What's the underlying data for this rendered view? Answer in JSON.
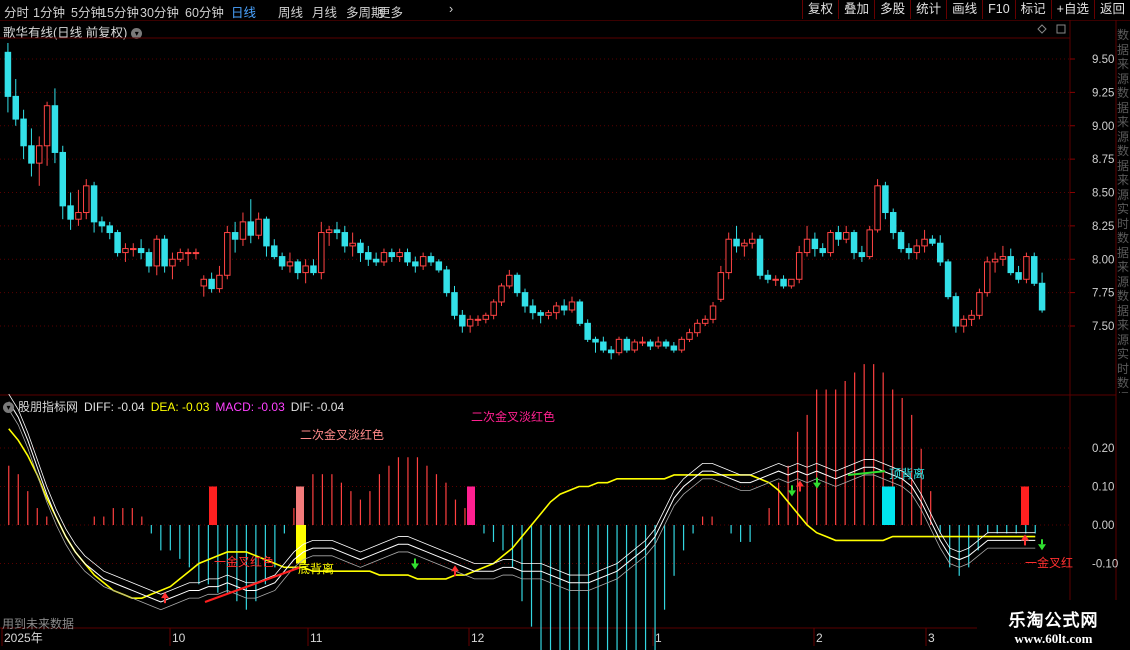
{
  "periods": [
    {
      "label": "分时",
      "active": false
    },
    {
      "label": "1分钟",
      "active": false
    },
    {
      "label": "5分钟",
      "active": false
    },
    {
      "label": "15分钟",
      "active": false
    },
    {
      "label": "30分钟",
      "active": false
    },
    {
      "label": "60分钟",
      "active": false
    },
    {
      "label": "日线",
      "active": true
    },
    {
      "label": "周线",
      "active": false
    },
    {
      "label": "月线",
      "active": false
    },
    {
      "label": "多周期",
      "active": false
    },
    {
      "label": "更多",
      "active": false
    }
  ],
  "toolbar_right": [
    "复权",
    "叠加",
    "多股",
    "统计",
    "画线",
    "F10",
    "标记",
    "+自选",
    "返回"
  ],
  "main_title": "歌华有线(日线 前复权)",
  "price_axis": [
    "9.50",
    "9.25",
    "9.00",
    "8.75",
    "8.50",
    "8.25",
    "8.00",
    "7.75",
    "7.50"
  ],
  "indicator": {
    "name": "股朋指标网",
    "diff_label": "DIFF: -0.04",
    "dea_label": "DEA: -0.03",
    "macd_label": "MACD: -0.03",
    "dif_label": "DIF: -0.04"
  },
  "macd_axis": [
    "0.20",
    "0.10",
    "0.00",
    "-0.10"
  ],
  "annotations": {
    "second_cross": "二次金叉淡红色",
    "second_cross_faded": "二次金叉淡红色",
    "first_cross_left": "一金叉红色",
    "bottom_divergence": "底背离",
    "top_divergence": "顶背离",
    "first_cross_right": "一金叉红"
  },
  "date_axis": [
    "2025年",
    "10",
    "11",
    "12",
    "1",
    "2",
    "3"
  ],
  "future_data_label": "用到未来数据",
  "watermark": {
    "line1": "乐淘公式网",
    "line2": "www.60lt.com"
  },
  "side_text": "数据来源数据来源数据来源实时数据来源数据来源实时数据来源板块资金流向",
  "colors": {
    "up": "#ff4444",
    "down": "#33e0e8",
    "dea": "#ffff00",
    "dif": "#ffffff",
    "bar_red": "#ff2020",
    "bar_pink": "#f27c7c",
    "bar_magenta": "#ff2090",
    "bar_yellow": "#ffff00",
    "bar_cyan": "#00e5ee",
    "grid": "#5a0000"
  },
  "chart_data": {
    "type": "candlestick",
    "ylim": [
      7.2,
      9.7
    ],
    "candles": [
      [
        9.55,
        9.62,
        9.1,
        9.22
      ],
      [
        9.22,
        9.35,
        9.0,
        9.05
      ],
      [
        9.05,
        9.12,
        8.75,
        8.85
      ],
      [
        8.85,
        8.98,
        8.62,
        8.72
      ],
      [
        8.72,
        8.92,
        8.55,
        8.85
      ],
      [
        8.85,
        9.18,
        8.7,
        9.15
      ],
      [
        9.15,
        9.28,
        8.72,
        8.8
      ],
      [
        8.8,
        8.85,
        8.3,
        8.4
      ],
      [
        8.4,
        8.5,
        8.22,
        8.3
      ],
      [
        8.3,
        8.52,
        8.25,
        8.35
      ],
      [
        8.35,
        8.6,
        8.3,
        8.55
      ],
      [
        8.55,
        8.58,
        8.2,
        8.28
      ],
      [
        8.28,
        8.32,
        8.2,
        8.25
      ],
      [
        8.25,
        8.28,
        8.15,
        8.2
      ],
      [
        8.2,
        8.22,
        8.02,
        8.05
      ],
      [
        8.05,
        8.12,
        7.98,
        8.08
      ],
      [
        8.08,
        8.12,
        8.02,
        8.08
      ],
      [
        8.08,
        8.15,
        8.0,
        8.05
      ],
      [
        8.05,
        8.08,
        7.9,
        7.95
      ],
      [
        7.95,
        8.18,
        7.88,
        8.15
      ],
      [
        8.15,
        8.18,
        7.9,
        7.95
      ],
      [
        7.95,
        8.05,
        7.85,
        8.0
      ],
      [
        8.0,
        8.08,
        7.98,
        8.05
      ],
      [
        8.05,
        8.08,
        7.95,
        8.05
      ],
      [
        8.05,
        8.08,
        8.0,
        8.05
      ],
      [
        7.8,
        7.88,
        7.72,
        7.85
      ],
      [
        7.85,
        7.9,
        7.75,
        7.78
      ],
      [
        7.78,
        7.95,
        7.75,
        7.88
      ],
      [
        7.88,
        8.25,
        7.85,
        8.2
      ],
      [
        8.2,
        8.28,
        8.05,
        8.15
      ],
      [
        8.15,
        8.35,
        8.1,
        8.28
      ],
      [
        8.28,
        8.45,
        8.12,
        8.18
      ],
      [
        8.18,
        8.35,
        8.15,
        8.3
      ],
      [
        8.3,
        8.32,
        8.02,
        8.1
      ],
      [
        8.1,
        8.15,
        8.0,
        8.02
      ],
      [
        8.02,
        8.05,
        7.92,
        7.95
      ],
      [
        7.95,
        8.05,
        7.9,
        7.98
      ],
      [
        7.98,
        8.0,
        7.85,
        7.9
      ],
      [
        7.9,
        8.0,
        7.82,
        7.95
      ],
      [
        7.95,
        8.0,
        7.88,
        7.9
      ],
      [
        7.9,
        8.28,
        7.85,
        8.2
      ],
      [
        8.2,
        8.25,
        8.1,
        8.22
      ],
      [
        8.22,
        8.28,
        8.15,
        8.2
      ],
      [
        8.2,
        8.25,
        8.05,
        8.1
      ],
      [
        8.1,
        8.2,
        8.02,
        8.12
      ],
      [
        8.12,
        8.15,
        7.98,
        8.05
      ],
      [
        8.05,
        8.1,
        7.95,
        8.0
      ],
      [
        8.0,
        8.05,
        7.95,
        7.98
      ],
      [
        7.98,
        8.08,
        7.95,
        8.05
      ],
      [
        8.05,
        8.08,
        7.98,
        8.02
      ],
      [
        8.02,
        8.08,
        7.98,
        8.05
      ],
      [
        8.05,
        8.08,
        7.95,
        7.98
      ],
      [
        7.98,
        8.02,
        7.9,
        7.95
      ],
      [
        7.95,
        8.05,
        7.92,
        8.02
      ],
      [
        8.02,
        8.05,
        7.95,
        7.98
      ],
      [
        7.98,
        8.0,
        7.9,
        7.92
      ],
      [
        7.92,
        7.95,
        7.72,
        7.75
      ],
      [
        7.75,
        7.8,
        7.55,
        7.58
      ],
      [
        7.58,
        7.62,
        7.45,
        7.5
      ],
      [
        7.5,
        7.58,
        7.45,
        7.55
      ],
      [
        7.55,
        7.58,
        7.5,
        7.55
      ],
      [
        7.55,
        7.6,
        7.52,
        7.58
      ],
      [
        7.58,
        7.7,
        7.55,
        7.68
      ],
      [
        7.68,
        7.82,
        7.65,
        7.8
      ],
      [
        7.8,
        7.92,
        7.78,
        7.88
      ],
      [
        7.88,
        7.9,
        7.72,
        7.75
      ],
      [
        7.75,
        7.78,
        7.6,
        7.65
      ],
      [
        7.65,
        7.7,
        7.55,
        7.6
      ],
      [
        7.6,
        7.62,
        7.52,
        7.58
      ],
      [
        7.58,
        7.62,
        7.55,
        7.6
      ],
      [
        7.6,
        7.68,
        7.55,
        7.65
      ],
      [
        7.65,
        7.7,
        7.58,
        7.62
      ],
      [
        7.62,
        7.72,
        7.6,
        7.68
      ],
      [
        7.68,
        7.7,
        7.5,
        7.52
      ],
      [
        7.52,
        7.55,
        7.38,
        7.4
      ],
      [
        7.4,
        7.42,
        7.3,
        7.38
      ],
      [
        7.38,
        7.42,
        7.3,
        7.32
      ],
      [
        7.32,
        7.35,
        7.25,
        7.3
      ],
      [
        7.3,
        7.42,
        7.28,
        7.4
      ],
      [
        7.4,
        7.42,
        7.3,
        7.32
      ],
      [
        7.32,
        7.4,
        7.3,
        7.38
      ],
      [
        7.38,
        7.42,
        7.35,
        7.38
      ],
      [
        7.38,
        7.4,
        7.32,
        7.35
      ],
      [
        7.35,
        7.42,
        7.33,
        7.38
      ],
      [
        7.38,
        7.4,
        7.33,
        7.35
      ],
      [
        7.35,
        7.38,
        7.3,
        7.32
      ],
      [
        7.32,
        7.42,
        7.3,
        7.4
      ],
      [
        7.4,
        7.48,
        7.38,
        7.45
      ],
      [
        7.45,
        7.55,
        7.42,
        7.52
      ],
      [
        7.52,
        7.58,
        7.5,
        7.55
      ],
      [
        7.55,
        7.68,
        7.52,
        7.65
      ],
      [
        7.7,
        7.95,
        7.68,
        7.9
      ],
      [
        7.9,
        8.2,
        7.85,
        8.15
      ],
      [
        8.15,
        8.25,
        8.05,
        8.1
      ],
      [
        8.1,
        8.15,
        8.02,
        8.12
      ],
      [
        8.12,
        8.2,
        8.08,
        8.15
      ],
      [
        8.15,
        8.18,
        7.85,
        7.88
      ],
      [
        7.88,
        7.92,
        7.82,
        7.85
      ],
      [
        7.85,
        7.88,
        7.8,
        7.85
      ],
      [
        7.85,
        7.88,
        7.78,
        7.8
      ],
      [
        7.8,
        7.85,
        7.78,
        7.85
      ],
      [
        7.85,
        8.1,
        7.82,
        8.05
      ],
      [
        8.05,
        8.25,
        8.02,
        8.15
      ],
      [
        8.15,
        8.2,
        8.02,
        8.08
      ],
      [
        8.08,
        8.12,
        8.02,
        8.05
      ],
      [
        8.05,
        8.22,
        8.02,
        8.2
      ],
      [
        8.2,
        8.25,
        8.1,
        8.15
      ],
      [
        8.15,
        8.25,
        8.12,
        8.2
      ],
      [
        8.2,
        8.22,
        8.0,
        8.05
      ],
      [
        8.05,
        8.1,
        7.98,
        8.02
      ],
      [
        8.02,
        8.25,
        8.0,
        8.22
      ],
      [
        8.22,
        8.6,
        8.2,
        8.55
      ],
      [
        8.55,
        8.58,
        8.3,
        8.35
      ],
      [
        8.35,
        8.38,
        8.15,
        8.2
      ],
      [
        8.2,
        8.22,
        8.05,
        8.08
      ],
      [
        8.08,
        8.12,
        8.0,
        8.05
      ],
      [
        8.05,
        8.15,
        8.0,
        8.1
      ],
      [
        8.1,
        8.22,
        8.05,
        8.15
      ],
      [
        8.15,
        8.18,
        8.1,
        8.12
      ],
      [
        8.12,
        8.18,
        7.95,
        7.98
      ],
      [
        7.98,
        8.0,
        7.7,
        7.72
      ],
      [
        7.72,
        7.75,
        7.45,
        7.5
      ],
      [
        7.5,
        7.58,
        7.45,
        7.55
      ],
      [
        7.55,
        7.62,
        7.5,
        7.58
      ],
      [
        7.58,
        7.78,
        7.55,
        7.75
      ],
      [
        7.75,
        8.02,
        7.72,
        7.98
      ],
      [
        7.98,
        8.05,
        7.9,
        8.0
      ],
      [
        8.0,
        8.1,
        7.95,
        8.02
      ],
      [
        8.02,
        8.08,
        7.88,
        7.9
      ],
      [
        7.9,
        7.95,
        7.82,
        7.85
      ],
      [
        7.85,
        8.05,
        7.82,
        8.02
      ],
      [
        8.02,
        8.05,
        7.8,
        7.82
      ],
      [
        7.82,
        7.9,
        7.6,
        7.62
      ]
    ],
    "dif": [
      0.32,
      0.28,
      0.22,
      0.15,
      0.08,
      0.02,
      -0.03,
      -0.07,
      -0.1,
      -0.12,
      -0.14,
      -0.15,
      -0.16,
      -0.17,
      -0.18,
      -0.19,
      -0.2,
      -0.19,
      -0.18,
      -0.17,
      -0.17,
      -0.16,
      -0.16,
      -0.15,
      -0.16,
      -0.17,
      -0.17,
      -0.16,
      -0.15,
      -0.12,
      -0.09,
      -0.07,
      -0.06,
      -0.06,
      -0.06,
      -0.07,
      -0.08,
      -0.09,
      -0.08,
      -0.07,
      -0.06,
      -0.05,
      -0.05,
      -0.06,
      -0.07,
      -0.08,
      -0.09,
      -0.1,
      -0.11,
      -0.12,
      -0.12,
      -0.12,
      -0.11,
      -0.11,
      -0.12,
      -0.12,
      -0.12,
      -0.13,
      -0.14,
      -0.15,
      -0.15,
      -0.15,
      -0.14,
      -0.13,
      -0.12,
      -0.1,
      -0.08,
      -0.06,
      -0.03,
      0.02,
      0.07,
      0.1,
      0.12,
      0.14,
      0.14,
      0.13,
      0.12,
      0.11,
      0.11,
      0.12,
      0.13,
      0.14,
      0.13,
      0.14,
      0.13,
      0.14,
      0.13,
      0.12,
      0.13,
      0.14,
      0.15,
      0.15,
      0.14,
      0.13,
      0.12,
      0.1,
      0.06,
      0.01,
      -0.04,
      -0.08,
      -0.09,
      -0.08,
      -0.06,
      -0.04,
      -0.04,
      -0.04,
      -0.04,
      -0.04,
      -0.04
    ],
    "dea": [
      0.25,
      0.22,
      0.18,
      0.13,
      0.07,
      0.02,
      -0.03,
      -0.07,
      -0.1,
      -0.13,
      -0.15,
      -0.17,
      -0.18,
      -0.19,
      -0.19,
      -0.18,
      -0.17,
      -0.16,
      -0.14,
      -0.12,
      -0.1,
      -0.09,
      -0.08,
      -0.07,
      -0.07,
      -0.07,
      -0.08,
      -0.09,
      -0.1,
      -0.11,
      -0.11,
      -0.11,
      -0.12,
      -0.12,
      -0.12,
      -0.12,
      -0.12,
      -0.12,
      -0.12,
      -0.13,
      -0.13,
      -0.13,
      -0.13,
      -0.14,
      -0.14,
      -0.14,
      -0.14,
      -0.13,
      -0.13,
      -0.12,
      -0.11,
      -0.1,
      -0.08,
      -0.06,
      -0.03,
      0.0,
      0.03,
      0.06,
      0.08,
      0.09,
      0.1,
      0.1,
      0.11,
      0.11,
      0.12,
      0.12,
      0.12,
      0.12,
      0.12,
      0.12,
      0.13,
      0.13,
      0.13,
      0.13,
      0.13,
      0.13,
      0.13,
      0.13,
      0.13,
      0.12,
      0.11,
      0.09,
      0.06,
      0.03,
      0.0,
      -0.02,
      -0.03,
      -0.04,
      -0.04,
      -0.04,
      -0.04,
      -0.04,
      -0.04,
      -0.03,
      -0.03,
      -0.03,
      -0.03,
      -0.03,
      -0.03,
      -0.03,
      -0.03,
      -0.03,
      -0.03,
      -0.03,
      -0.03,
      -0.03,
      -0.03,
      -0.03,
      -0.03
    ]
  }
}
